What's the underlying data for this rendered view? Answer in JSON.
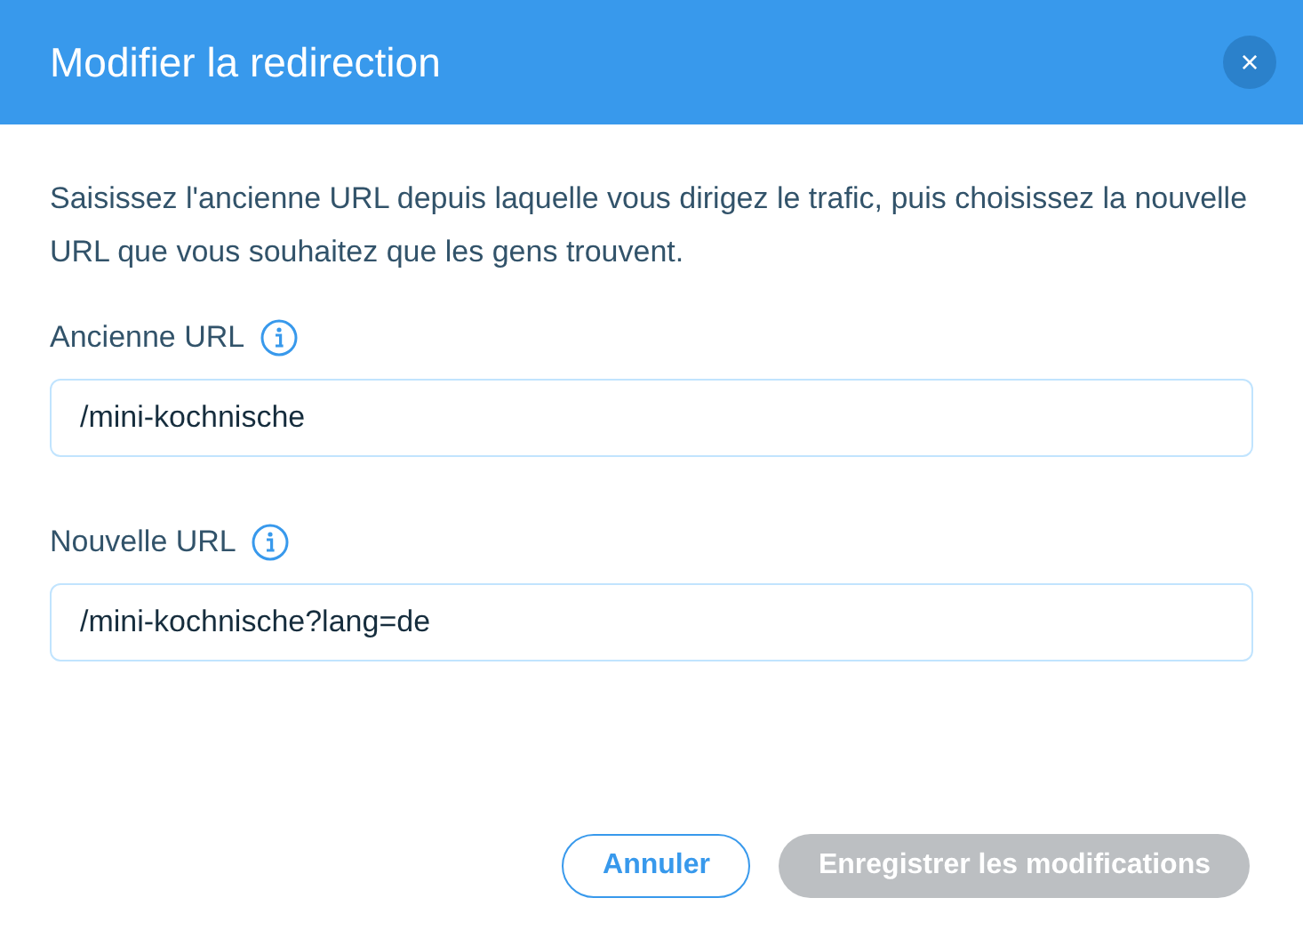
{
  "dialog": {
    "title": "Modifier la redirection",
    "close_label": "×"
  },
  "description": "Saisissez l'ancienne URL depuis laquelle vous dirigez le trafic, puis choisissez la nouvelle URL que vous souhaitez que les gens trouvent.",
  "fields": [
    {
      "label": "Ancienne URL",
      "value": "/mini-kochnische"
    },
    {
      "label": "Nouvelle URL",
      "value": "/mini-kochnische?lang=de"
    }
  ],
  "buttons": [
    {
      "label": "Annuler",
      "kind": "secondary",
      "disabled": false
    },
    {
      "label": "Enregistrer les modifications",
      "kind": "primary",
      "disabled": true
    }
  ]
}
